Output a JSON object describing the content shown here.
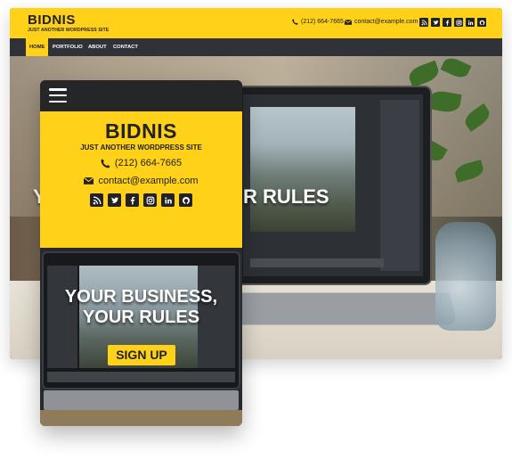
{
  "desktop": {
    "brand": "BIDNIS",
    "tagline": "JUST ANOTHER WORDPRESS SITE",
    "phone": "(212) 664-7665",
    "email": "contact@example.com",
    "social": [
      "rss-icon",
      "twitter-icon",
      "facebook-icon",
      "instagram-icon",
      "linkedin-icon",
      "github-icon"
    ],
    "nav": [
      {
        "label": "HOME",
        "active": true
      },
      {
        "label": "PORTFOLIO",
        "active": false
      },
      {
        "label": "ABOUT",
        "active": false
      },
      {
        "label": "CONTACT",
        "active": false
      }
    ],
    "hero_title_left": "Y",
    "hero_title_right": "R RULES"
  },
  "mobile": {
    "brand": "BIDNIS",
    "tagline": "JUST ANOTHER WORDPRESS SITE",
    "phone": "(212) 664-7665",
    "email": "contact@example.com",
    "social": [
      "rss-icon",
      "twitter-icon",
      "facebook-icon",
      "instagram-icon",
      "linkedin-icon",
      "github-icon"
    ],
    "hero_line1": "YOUR BUSINESS,",
    "hero_line2": "YOUR RULES",
    "cta": "SIGN UP"
  },
  "colors": {
    "accent": "#ffd118",
    "nav": "#2f3236",
    "dark": "#222222"
  }
}
